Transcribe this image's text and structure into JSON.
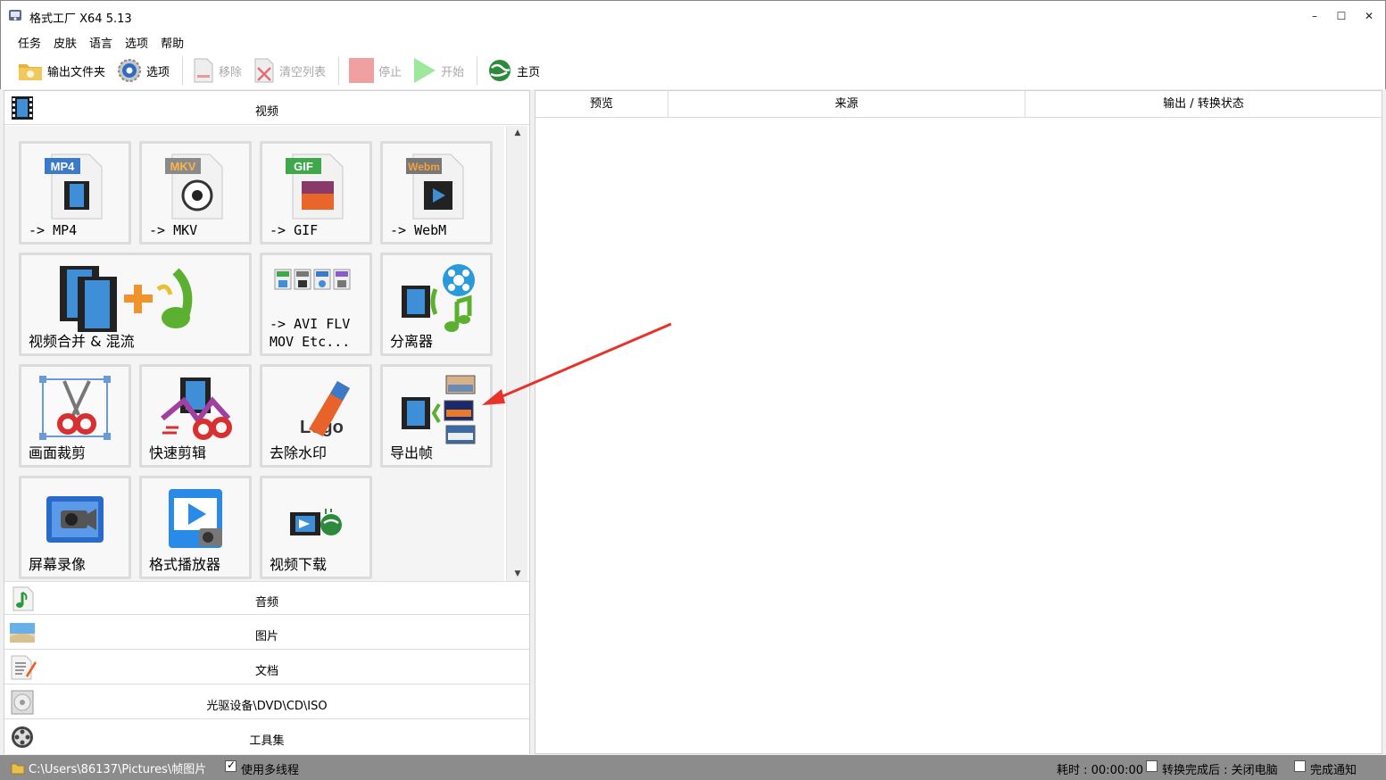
{
  "window": {
    "title": "格式工厂 X64 5.13",
    "minimize": "–",
    "maximize": "☐",
    "close": "✕"
  },
  "menu": [
    "任务",
    "皮肤",
    "语言",
    "选项",
    "帮助"
  ],
  "toolbar": {
    "output_folder": "输出文件夹",
    "options": "选项",
    "remove": "移除",
    "clear_list": "清空列表",
    "stop": "停止",
    "start": "开始",
    "home": "主页"
  },
  "categories": {
    "video": "视频",
    "audio": "音频",
    "image": "图片",
    "document": "文档",
    "rom": "光驱设备\\DVD\\CD\\ISO",
    "tools": "工具集"
  },
  "tiles": [
    {
      "label": "-> MP4",
      "badge": "MP4",
      "badge_color": "#3a7ac8"
    },
    {
      "label": "-> MKV",
      "badge": "MKV",
      "badge_color": "#8a8a8a"
    },
    {
      "label": "-> GIF",
      "badge": "GIF",
      "badge_color": "#3ea84a"
    },
    {
      "label": "-> WebM",
      "badge": "Webm",
      "badge_color": "#777777"
    },
    {
      "label": "视频合并 & 混流"
    },
    {
      "label": "-> AVI FLV\nMOV Etc..."
    },
    {
      "label": "分离器"
    },
    {
      "label": "画面裁剪"
    },
    {
      "label": "快速剪辑"
    },
    {
      "label": "去除水印",
      "icon_text": "Logo"
    },
    {
      "label": "导出帧"
    },
    {
      "label": "屏幕录像"
    },
    {
      "label": "格式播放器"
    },
    {
      "label": "视频下载"
    }
  ],
  "task_columns": [
    "预览",
    "来源",
    "输出 / 转换状态"
  ],
  "status": {
    "path": "C:\\Users\\86137\\Pictures\\帧图片",
    "multithread": "使用多线程",
    "elapsed": "耗时 : 00:00:00",
    "after_done": "转换完成后 : 关闭电脑",
    "notify": "完成通知"
  },
  "colors": {
    "annotation_arrow": "#e8322c",
    "statusbar": "#8c8c8c"
  }
}
